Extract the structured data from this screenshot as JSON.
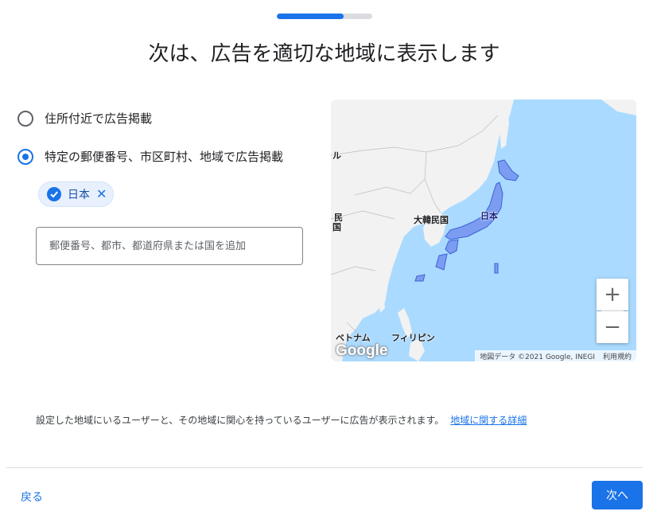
{
  "progress": {
    "value": 0.7
  },
  "page_title": "次は、広告を適切な地域に表示します",
  "options": {
    "near_address": {
      "label": "住所付近で広告掲載",
      "selected": false
    },
    "specific_areas": {
      "label": "特定の郵便番号、市区町村、地域で広告掲載",
      "selected": true
    }
  },
  "selected_location": {
    "label": "日本",
    "remove_icon": "close-icon",
    "check_icon": "check-circle-icon"
  },
  "location_input": {
    "value": "",
    "placeholder": "郵便番号、都市、都道府県または国を追加"
  },
  "map": {
    "labels": {
      "korea": "大韓民国",
      "japan": "日本",
      "china_partial": "民",
      "china_partial2": "国",
      "mongolia_partial": "ル",
      "vietnam": "ベトナム",
      "philippines": "フィリピン"
    },
    "zoom_in": "+",
    "zoom_out": "−",
    "logo": "Google",
    "attribution": "地図データ ©2021 Google, INEGI",
    "terms": "利用規約",
    "colors": {
      "water": "#aadaff",
      "land": "#f2f2f2",
      "highlight": "#7b9cf0",
      "highlight_border": "#3b62d8"
    }
  },
  "description": "設定した地域にいるユーザーと、その地域に関心を持っているユーザーに広告が表示されます。",
  "learn_more": "地域に関する詳細",
  "footer": {
    "back": "戻る",
    "next": "次へ"
  },
  "colors": {
    "accent": "#1a73e8"
  }
}
